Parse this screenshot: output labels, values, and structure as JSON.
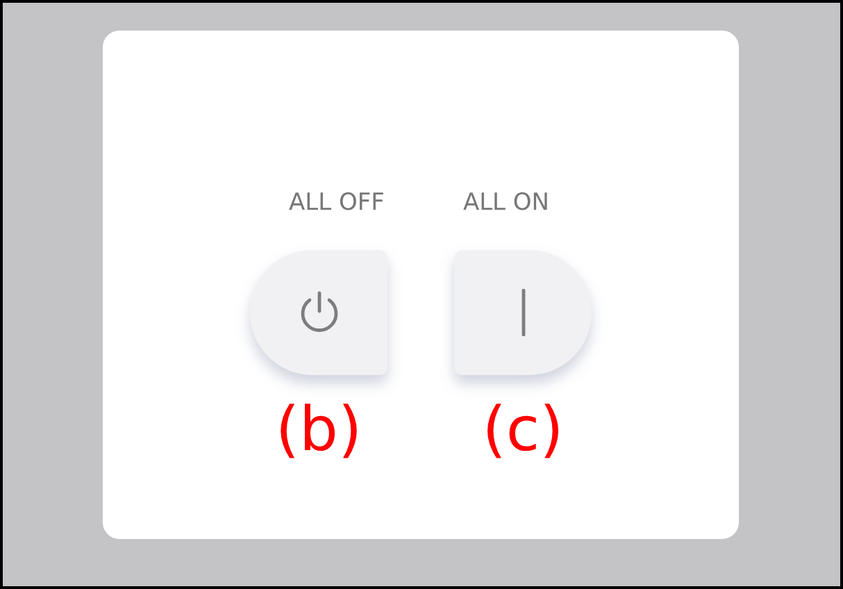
{
  "buttons": [
    {
      "label": "ALL OFF",
      "kind": "off",
      "caption": "(b)"
    },
    {
      "label": "ALL ON",
      "kind": "on",
      "caption": "(c)"
    }
  ]
}
